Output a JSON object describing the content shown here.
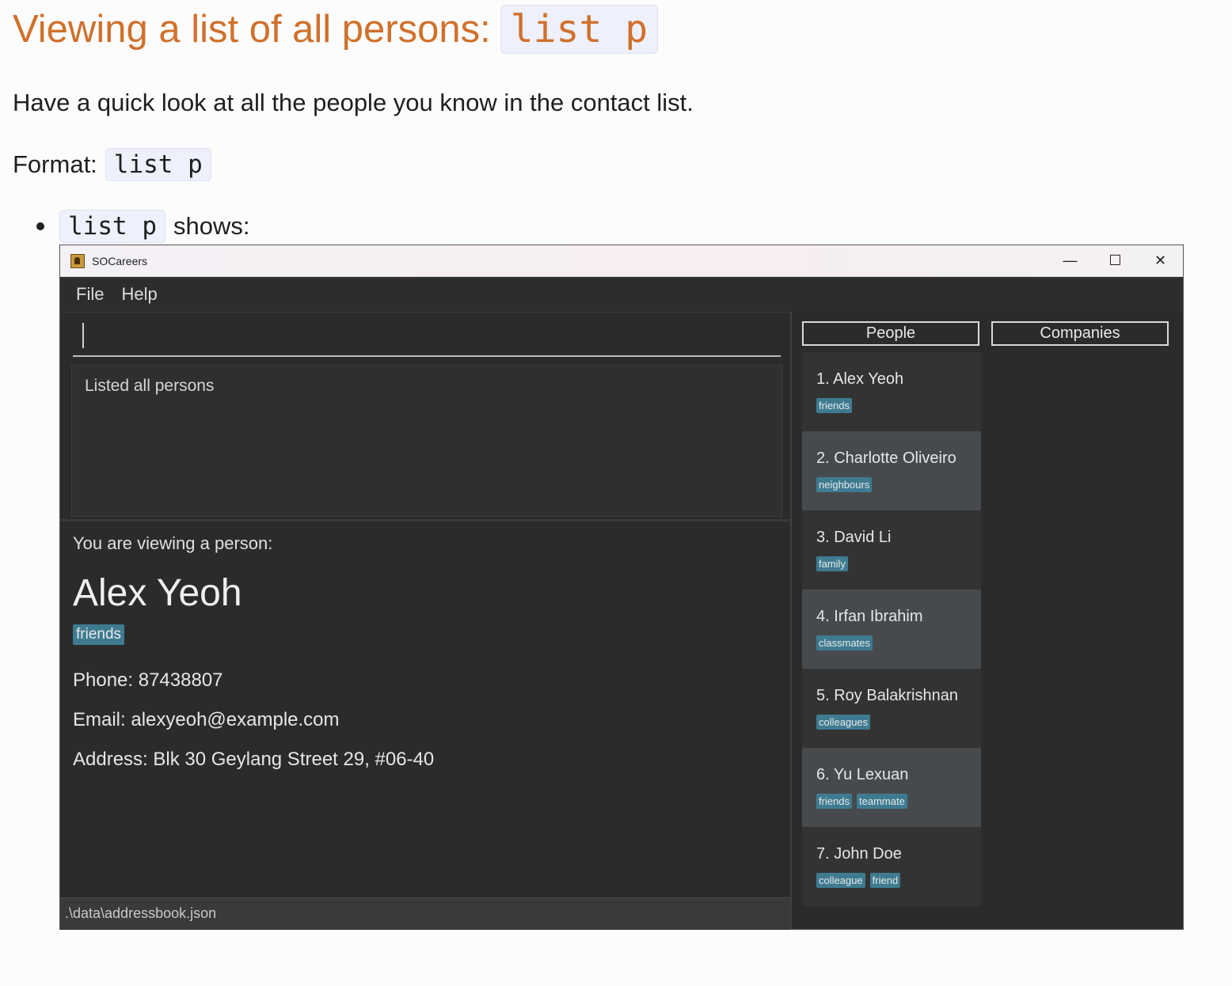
{
  "doc": {
    "heading_text": "Viewing a list of all persons:",
    "heading_code": "list p",
    "description": "Have a quick look at all the people you know in the contact list.",
    "format_label": "Format:",
    "format_code": "list p",
    "bullet_code": "list p",
    "bullet_text": "shows:"
  },
  "window": {
    "title": "SOCareers",
    "minimize": "—",
    "maximize": "☐",
    "close": "✕"
  },
  "menu": {
    "file": "File",
    "help": "Help"
  },
  "command": {
    "value": ""
  },
  "result": {
    "text": "Listed all persons"
  },
  "detail": {
    "viewing_label": "You are viewing a person:",
    "name": "Alex Yeoh",
    "tag": "friends",
    "phone": "Phone: 87438807",
    "email": "Email: alexyeoh@example.com",
    "address": "Address: Blk 30 Geylang Street 29, #06-40"
  },
  "status": {
    "path": ".\\data\\addressbook.json"
  },
  "tabs": {
    "people": "People",
    "companies": "Companies"
  },
  "people": [
    {
      "label": "1.  Alex Yeoh",
      "tags": [
        "friends"
      ]
    },
    {
      "label": "2.  Charlotte Oliveiro",
      "tags": [
        "neighbours"
      ]
    },
    {
      "label": "3.  David Li",
      "tags": [
        "family"
      ]
    },
    {
      "label": "4.  Irfan Ibrahim",
      "tags": [
        "classmates"
      ]
    },
    {
      "label": "5.  Roy Balakrishnan",
      "tags": [
        "colleagues"
      ]
    },
    {
      "label": "6.  Yu Lexuan",
      "tags": [
        "friends",
        "teammate"
      ]
    },
    {
      "label": "7.  John Doe",
      "tags": [
        "colleague",
        "friend"
      ]
    }
  ],
  "colors": {
    "heading": "#d0702b",
    "tag_bg": "#3e7b91",
    "app_bg": "#2b2b2b"
  }
}
